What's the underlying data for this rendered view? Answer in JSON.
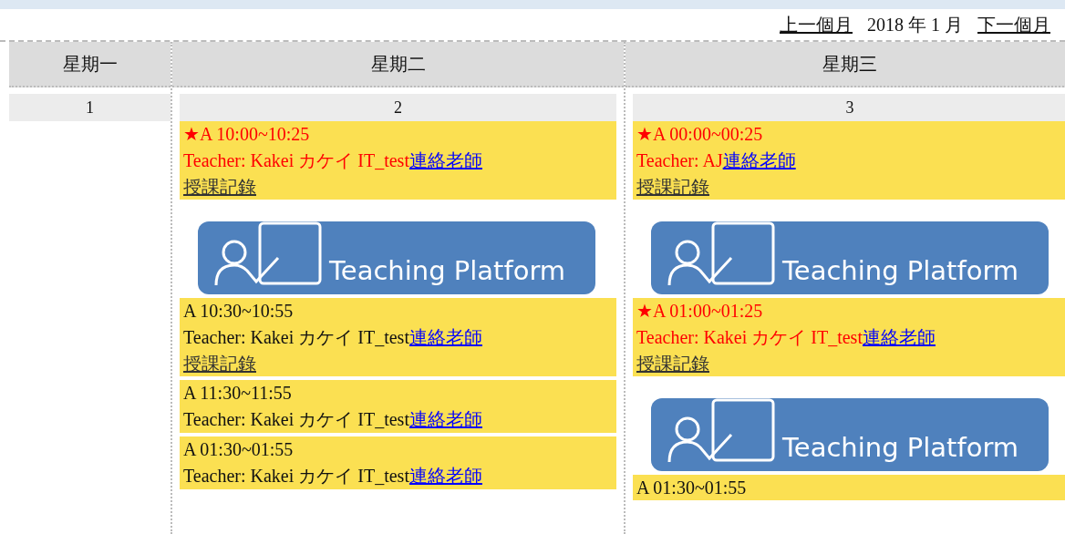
{
  "month_nav": {
    "prev": "上一個月",
    "current": "2018 年 1 月",
    "next": "下一個月"
  },
  "columns": [
    {
      "header": "星期一",
      "day": "1"
    },
    {
      "header": "星期二",
      "day": "2",
      "items": [
        {
          "kind": "lesson",
          "starred": true,
          "time": "★A 10:00~10:25",
          "teacher": "Teacher: Kakei カケイ IT_test",
          "contact": "連絡老師",
          "record": "授課記錄"
        },
        {
          "kind": "platform",
          "label": "Teaching Platform"
        },
        {
          "kind": "lesson",
          "starred": false,
          "time": "A 10:30~10:55",
          "teacher": "Teacher: Kakei カケイ IT_test",
          "contact": "連絡老師",
          "record": "授課記錄"
        },
        {
          "kind": "lesson",
          "starred": false,
          "time": "A 11:30~11:55",
          "teacher": "Teacher: Kakei カケイ IT_test",
          "contact": "連絡老師"
        },
        {
          "kind": "lesson",
          "starred": false,
          "time": "A 01:30~01:55",
          "teacher": "Teacher: Kakei カケイ IT_test",
          "contact": "連絡老師"
        }
      ]
    },
    {
      "header": "星期三",
      "day": "3",
      "items": [
        {
          "kind": "lesson",
          "starred": true,
          "time": "★A 00:00~00:25",
          "teacher": "Teacher: AJ",
          "contact": "連絡老師",
          "record": "授課記錄"
        },
        {
          "kind": "platform",
          "label": "Teaching Platform"
        },
        {
          "kind": "lesson",
          "starred": true,
          "time": "★A 01:00~01:25",
          "teacher": "Teacher: Kakei カケイ IT_test",
          "contact": "連絡老師",
          "record": "授課記錄"
        },
        {
          "kind": "platform",
          "label": "Teaching Platform"
        },
        {
          "kind": "lesson",
          "starred": false,
          "time": "A 01:30~01:55"
        }
      ]
    }
  ]
}
